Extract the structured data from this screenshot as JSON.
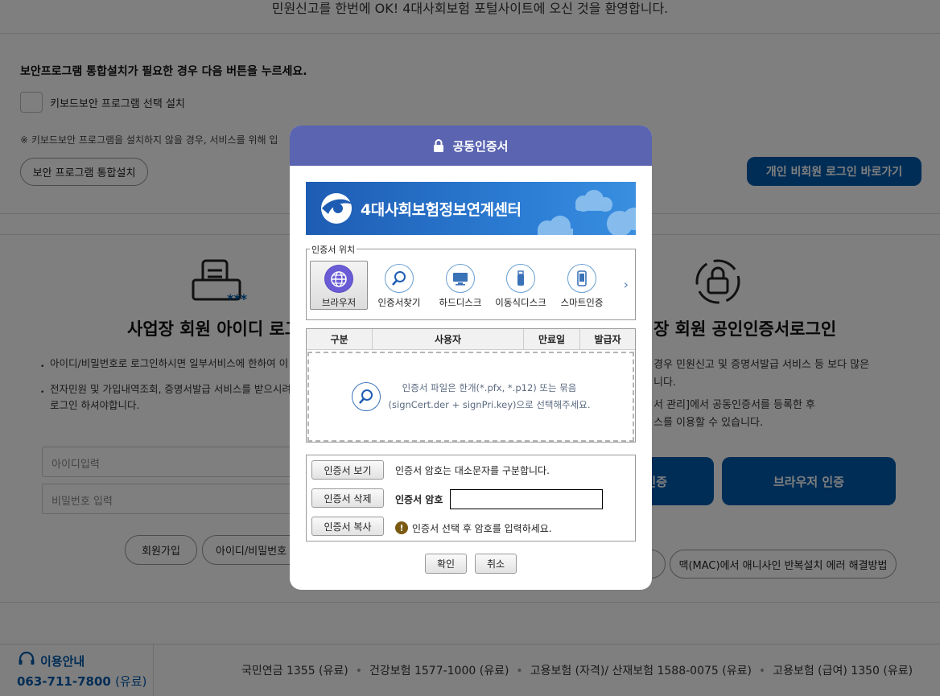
{
  "page": {
    "welcome": "민원신고를 한번에 OK! 4대사회보험 포털사이트에 오신 것을 환영합니다.",
    "security": {
      "title": "보안프로그램 통합설치가 필요한 경우 다음 버튼을 누르세요.",
      "keyboard_label": "키보드보안 프로그램 선택 설치",
      "notice": "※ 키보드보안 프로그램을 설치하지 않을 경우, 서비스를 위해 입",
      "install_button": "보안 프로그램 통합설치"
    },
    "guest_login_button": "개인 비회원 로그인 바로가기",
    "id_login": {
      "title": "사업장 회원 아이디 로그",
      "bullet1": "아이디/비밀번호로 로그인하시면 일부서비스에 한하여 이",
      "bullet2_line1": "전자민원 및 가입내역조회, 증명서발급 서비스를 받으시려",
      "bullet2_line2": "로그인 하셔야합니다.",
      "id_placeholder": "아이디입력",
      "pw_placeholder": "비밀번호 입력",
      "join_button": "회원가입",
      "find_button": "아이디/비밀번호"
    },
    "cert_login": {
      "title": "장 회원 공인인증서로그인",
      "line1": "경우 민원신고 및 증명서발급 서비스 등 보다 많은",
      "line2": "니다.",
      "line3": "서 관리]에서 공동인증서를 등록한 후",
      "line4": "스를 이용할 수 있습니다.",
      "cert_button_partial": "인증",
      "browser_button": "브라우저 인증",
      "mac_button": "맥(MAC)에서 애니사인 반복설치 에러 해결방법"
    },
    "footer": {
      "label": "이용안내",
      "phone": "063-711-7800",
      "phone_note": "(유료)",
      "items": [
        "국민연금 1355 (유료)",
        "건강보험 1577-1000 (유료)",
        "고용보험 (자격)/ 산재보험 1588-0075 (유료)",
        "고용보험 (급여) 1350 (유료)"
      ]
    }
  },
  "dialog": {
    "title": "공동인증서",
    "banner_title": "4대사회보험정보연계센터",
    "location_legend": "인증서 위치",
    "locations": [
      {
        "label": "브라우저",
        "icon": "globe-icon",
        "selected": true
      },
      {
        "label": "인증서찾기",
        "icon": "magnifier-icon",
        "selected": false
      },
      {
        "label": "하드디스크",
        "icon": "monitor-icon",
        "selected": false
      },
      {
        "label": "이동식디스크",
        "icon": "usb-icon",
        "selected": false
      },
      {
        "label": "스마트인증",
        "icon": "smartphone-icon",
        "selected": false
      }
    ],
    "table_headers": [
      "구분",
      "사용자",
      "만료일",
      "발급자"
    ],
    "drop_line1": "인증서 파일은 한개(*.pfx, *.p12) 또는 묶음",
    "drop_line2": "(signCert.der + signPri.key)으로 선택해주세요.",
    "view_button": "인증서 보기",
    "delete_button": "인증서 삭제",
    "copy_button": "인증서 복사",
    "case_notice": "인증서 암호는 대소문자를 구분합니다.",
    "password_label": "인증서 암호",
    "password_value": "",
    "warning_text": "인증서 선택 후 암호를 입력하세요.",
    "ok_button": "확인",
    "cancel_button": "취소"
  },
  "colors": {
    "header": "#5a64b0",
    "brand_blue": "#005bac",
    "banner": "#2d7fd6"
  }
}
